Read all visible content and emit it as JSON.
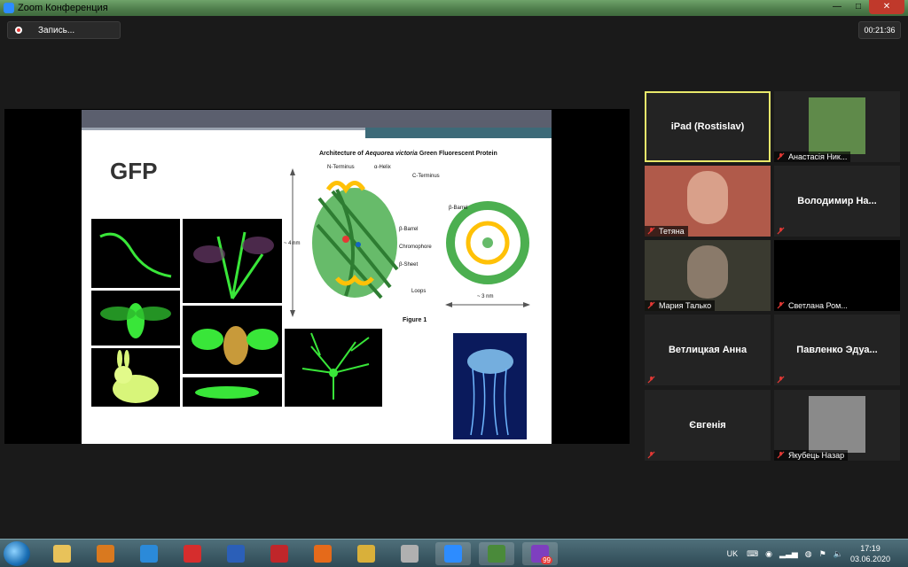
{
  "window": {
    "title": "Zoom Конференция",
    "minimize": "—",
    "maximize": "□",
    "close": "✕"
  },
  "meeting": {
    "record_label": "Запись...",
    "timer": "00:21:36"
  },
  "slide": {
    "title": "GFP",
    "figure_title_pre": "Architecture of ",
    "figure_title_italic": "Aequorea victoria",
    "figure_title_post": " Green Fluorescent Protein",
    "labels": {
      "n_terminus": "N-Terminus",
      "alpha_helix": "α-Helix",
      "c_terminus": "C-Terminus",
      "beta_barrel_1": "β-Barrel",
      "beta_barrel_2": "β-Barrel",
      "chromophore": "Chromophore",
      "beta_sheet": "β-Sheet",
      "loops": "Loops",
      "size_4nm": "~ 4 nm",
      "size_3nm": "~ 3 nm"
    },
    "figure_caption": "Figure 1"
  },
  "participants": [
    {
      "name": "iPad (Rostislav)",
      "style": "name-only",
      "active": true,
      "muted": false
    },
    {
      "name": "Анастасія Ник...",
      "style": "avatar",
      "muted": true
    },
    {
      "name": "Тетяна",
      "style": "video",
      "muted": true
    },
    {
      "name": "Володимир  На...",
      "style": "name-only",
      "muted": true
    },
    {
      "name": "Мария Талько",
      "style": "video",
      "muted": true
    },
    {
      "name": "Светлана Ром...",
      "style": "black",
      "muted": true
    },
    {
      "name": "Ветлицкая Анна",
      "style": "name-only",
      "muted": true
    },
    {
      "name": "Павленко  Эдуа...",
      "style": "name-only",
      "muted": true
    },
    {
      "name": "Євгенія",
      "style": "name-only",
      "muted": true
    },
    {
      "name": "Якубець Назар",
      "style": "avatar",
      "muted": true
    }
  ],
  "taskbar": {
    "apps": [
      "explorer",
      "media-player",
      "teamviewer",
      "opera",
      "word",
      "pdf-reader",
      "firefox",
      "disk-tool",
      "video-reel",
      "zoom",
      "monitor",
      "viber"
    ],
    "viber_badge": "99",
    "language": "UK",
    "time": "17:19",
    "date": "03.06.2020"
  },
  "colors": {
    "accent_active": "#e8e86a",
    "mute_red": "#e53935",
    "zoom_blue": "#2d8cff",
    "gfp_green": "#39e639"
  }
}
